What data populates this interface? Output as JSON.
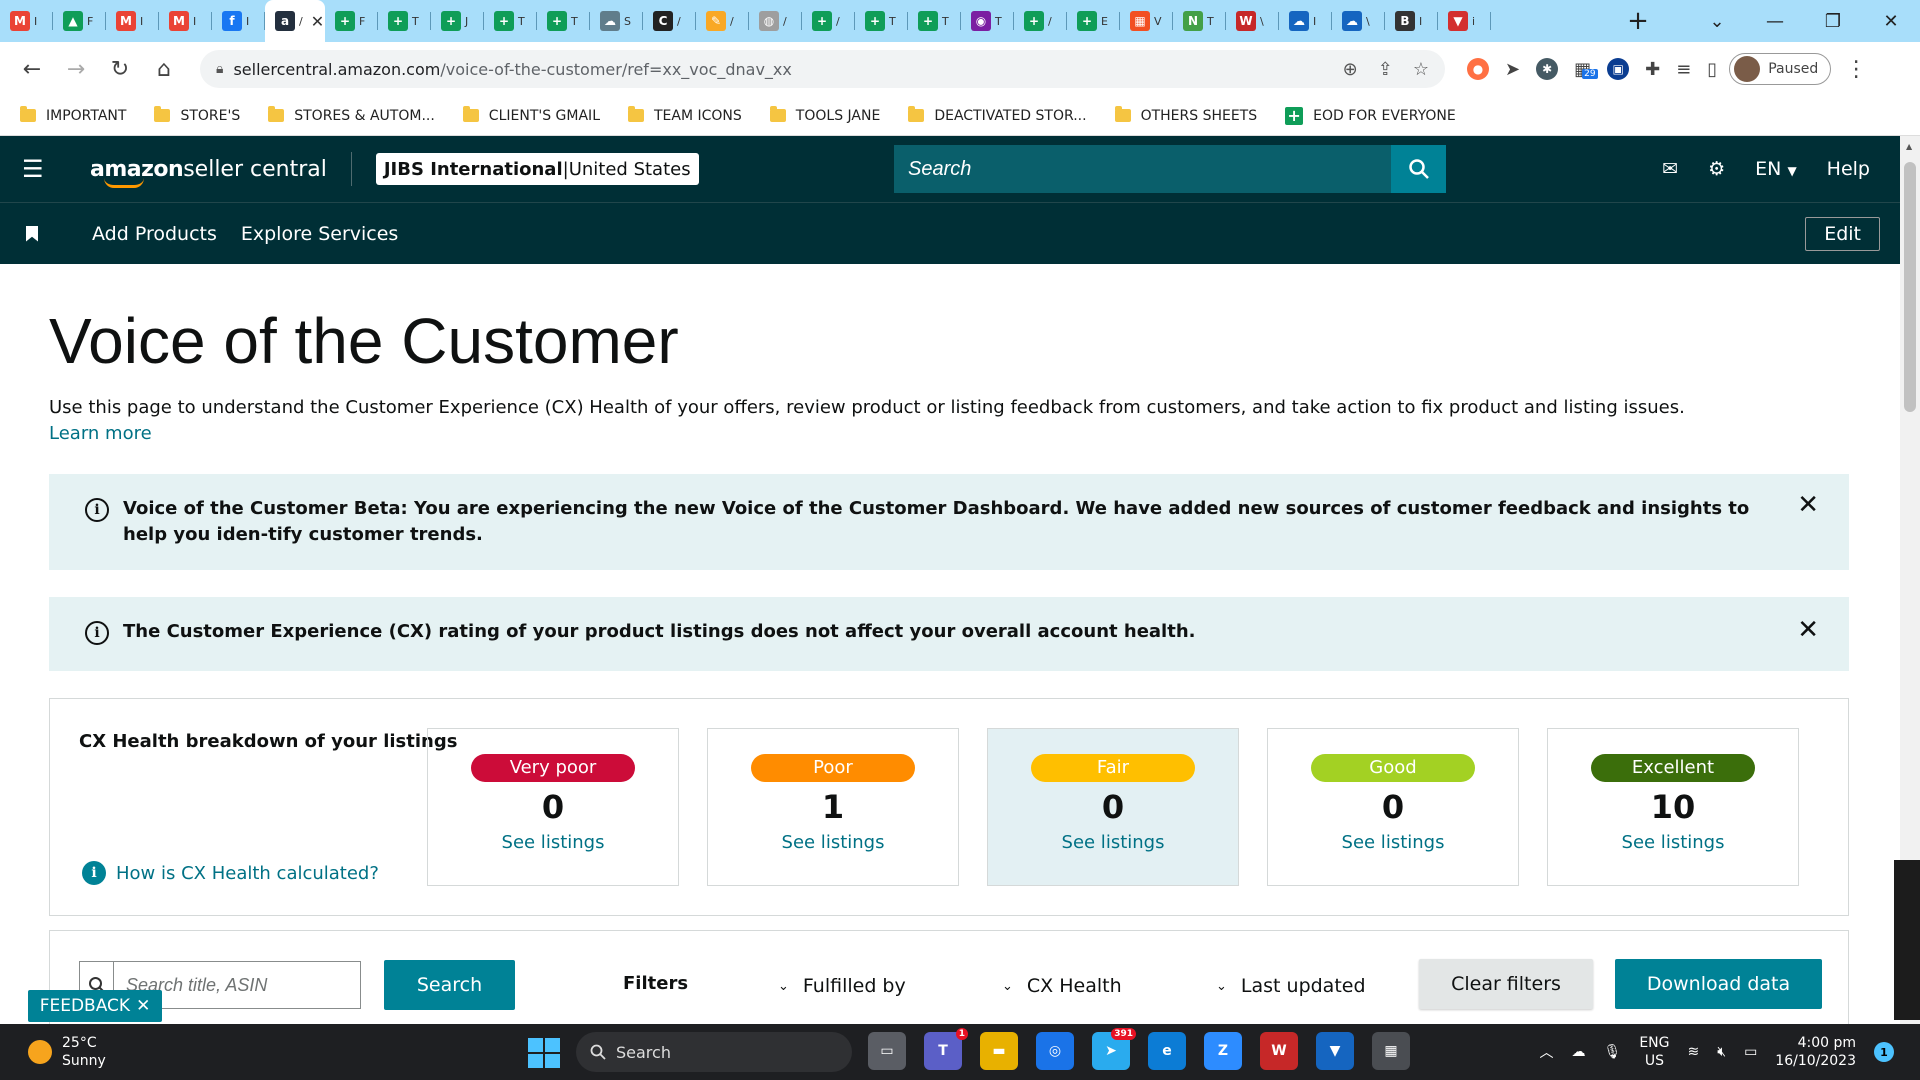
{
  "browser": {
    "tabs": [
      {
        "icon": "gmail-icon",
        "letter": "M",
        "color": "#ea4335",
        "label": "I"
      },
      {
        "icon": "google-drive-icon",
        "letter": "▲",
        "color": "#0f9d58",
        "label": "F"
      },
      {
        "icon": "gmail-icon",
        "letter": "M",
        "color": "#ea4335",
        "label": "I"
      },
      {
        "icon": "gmail-icon",
        "letter": "M",
        "color": "#ea4335",
        "label": "I"
      },
      {
        "icon": "facebook-icon",
        "letter": "f",
        "color": "#1877f2",
        "label": "I"
      },
      {
        "icon": "amazon-icon",
        "letter": "a",
        "color": "#232f3e",
        "label": "/"
      },
      {
        "icon": "sheets-icon",
        "letter": "+",
        "color": "#0f9d58",
        "label": "F"
      },
      {
        "icon": "sheets-icon",
        "letter": "+",
        "color": "#0f9d58",
        "label": "T"
      },
      {
        "icon": "sheets-icon",
        "letter": "+",
        "color": "#0f9d58",
        "label": "J"
      },
      {
        "icon": "sheets-icon",
        "letter": "+",
        "color": "#0f9d58",
        "label": "T"
      },
      {
        "icon": "sheets-icon",
        "letter": "+",
        "color": "#0f9d58",
        "label": "T"
      },
      {
        "icon": "cloud-icon",
        "letter": "☁",
        "color": "#607d8b",
        "label": "S"
      },
      {
        "icon": "c-icon",
        "letter": "C",
        "color": "#222222",
        "label": "/"
      },
      {
        "icon": "pen-icon",
        "letter": "✎",
        "color": "#f9a825",
        "label": "/"
      },
      {
        "icon": "globe-icon",
        "letter": "◍",
        "color": "#9e9e9e",
        "label": "/"
      },
      {
        "icon": "sheets-icon",
        "letter": "+",
        "color": "#0f9d58",
        "label": "/"
      },
      {
        "icon": "sheets-icon",
        "letter": "+",
        "color": "#0f9d58",
        "label": "T"
      },
      {
        "icon": "sheets-icon",
        "letter": "+",
        "color": "#0f9d58",
        "label": "T"
      },
      {
        "icon": "chat-icon",
        "letter": "◉",
        "color": "#7b1fa2",
        "label": "T"
      },
      {
        "icon": "sheets-icon",
        "letter": "+",
        "color": "#0f9d58",
        "label": "/"
      },
      {
        "icon": "sheets-icon",
        "letter": "+",
        "color": "#0f9d58",
        "label": "E"
      },
      {
        "icon": "windows-icon",
        "letter": "▦",
        "color": "#f25022",
        "label": "V"
      },
      {
        "icon": "n-icon",
        "letter": "N",
        "color": "#43a047",
        "label": "T"
      },
      {
        "icon": "wps-icon",
        "letter": "W",
        "color": "#c62828",
        "label": "\\"
      },
      {
        "icon": "cloud-icon",
        "letter": "☁",
        "color": "#1565c0",
        "label": "I"
      },
      {
        "icon": "cloud-icon",
        "letter": "☁",
        "color": "#1565c0",
        "label": "\\"
      },
      {
        "icon": "b-icon",
        "letter": "B",
        "color": "#333333",
        "label": "I"
      },
      {
        "icon": "shield-icon",
        "letter": "▼",
        "color": "#d32f2f",
        "label": "i"
      }
    ],
    "active_tab": 5,
    "url_host": "sellercentral.amazon.com",
    "url_path": "/voice-of-the-customer/ref=xx_voc_dnav_xx",
    "profile_status": "Paused",
    "ext_badge": "29",
    "bookmarks": [
      {
        "label": "IMPORTANT",
        "icon": "folder-icon"
      },
      {
        "label": "STORE'S",
        "icon": "folder-icon"
      },
      {
        "label": "STORES & AUTOM...",
        "icon": "folder-icon"
      },
      {
        "label": "CLIENT'S GMAIL",
        "icon": "folder-icon"
      },
      {
        "label": "TEAM ICONS",
        "icon": "folder-icon"
      },
      {
        "label": "TOOLS JANE",
        "icon": "folder-icon"
      },
      {
        "label": "DEACTIVATED STOR...",
        "icon": "folder-icon"
      },
      {
        "label": "OTHERS SHEETS",
        "icon": "folder-icon"
      },
      {
        "label": "EOD FOR EVERYONE",
        "icon": "sheets-icon"
      }
    ]
  },
  "header": {
    "logo_bold": "amazon",
    "logo_rest": " seller central",
    "account_name": "JIBS International",
    "account_sep": " | ",
    "account_region": "United States",
    "search_placeholder": "Search",
    "lang": "EN",
    "help": "Help",
    "nav": [
      "Add Products",
      "Explore Services"
    ],
    "edit": "Edit"
  },
  "page": {
    "title": "Voice of the Customer",
    "description": "Use this page to understand the Customer Experience (CX) Health of your offers, review product or listing feedback from customers, and take action to fix product and listing issues.",
    "learn_more": "Learn more",
    "alert1": "Voice of the Customer Beta: You are experiencing the new Voice of the Customer Dashboard. We have added new sources of customer feedback and insights to help you iden-tify customer trends.",
    "alert2": "The Customer Experience (CX) rating of your product listings does not affect your overall account health.",
    "cx_title": "CX Health breakdown of your listings",
    "cx_how": "How is CX Health calculated?",
    "tiles": [
      {
        "label": "Very poor",
        "count": "0",
        "link": "See listings",
        "color": "#cc0c39"
      },
      {
        "label": "Poor",
        "count": "1",
        "link": "See listings",
        "color": "#ff8c00"
      },
      {
        "label": "Fair",
        "count": "0",
        "link": "See listings",
        "color": "#ffbf00"
      },
      {
        "label": "Good",
        "count": "0",
        "link": "See listings",
        "color": "#a3d123"
      },
      {
        "label": "Excellent",
        "count": "10",
        "link": "See listings",
        "color": "#3b6e0b"
      }
    ],
    "selected_tile": 2,
    "search_placeholder": "Search title, ASIN",
    "search_btn": "Search",
    "filters_label": "Filters",
    "filter_fulfilled": "Fulfilled by",
    "filter_cx": "CX Health",
    "filter_updated": "Last updated",
    "clear_filters": "Clear filters",
    "download": "Download data",
    "feedback": "FEEDBACK"
  },
  "taskbar": {
    "temp": "25°C",
    "weather": "Sunny",
    "search": "Search",
    "lang1": "ENG",
    "lang2": "US",
    "time": "4:00 pm",
    "date": "16/10/2023",
    "notifications": "1",
    "telegram_badge": "391",
    "teams_badge": "1"
  }
}
